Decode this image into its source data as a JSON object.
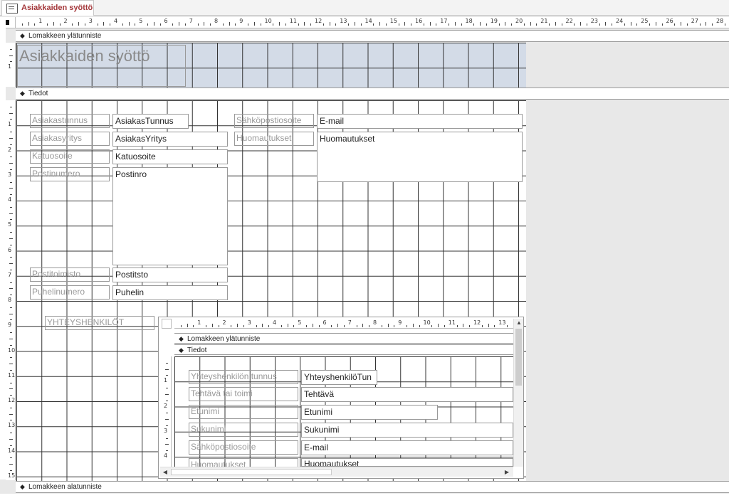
{
  "tab": {
    "title": "Asiakkaiden syöttö"
  },
  "sections": {
    "header": "Lomakkeen ylätunniste",
    "detail": "Tiedot",
    "footer": "Lomakkeen alatunniste"
  },
  "form": {
    "title": "Asiakkaiden syöttö",
    "fields": [
      {
        "label": "Asiakastunnus",
        "control": "AsiakasTunnus"
      },
      {
        "label": "Asiakasyritys",
        "control": "AsiakasYritys"
      },
      {
        "label": "Katuosoite",
        "control": "Katuosoite"
      },
      {
        "label": "Postinumero",
        "control": "Postinro"
      },
      {
        "label": "Postitoimisto",
        "control": "Postitsto"
      },
      {
        "label": "Puhelinumero",
        "control": "Puhelin"
      },
      {
        "label": "Sähköpostiosoite",
        "control": "E-mail"
      },
      {
        "label": "Huomautukset",
        "control": "Huomautukset"
      }
    ],
    "subform_label": "YHTEYSHENKILÖT"
  },
  "subform": {
    "sections": {
      "header": "Lomakkeen ylätunniste",
      "detail": "Tiedot"
    },
    "fields": [
      {
        "label": "Yhteyshenkilön tunnus",
        "control": "YhteyshenkilöTun"
      },
      {
        "label": "Tehtävä tai toimi",
        "control": "Tehtävä"
      },
      {
        "label": "Etunimi",
        "control": "Etunimi"
      },
      {
        "label": "Sukunimi",
        "control": "Sukunimi"
      },
      {
        "label": "Sähköpostiosoite",
        "control": "E-mail"
      },
      {
        "label": "Huomautukset",
        "control": "Huomautukset"
      }
    ]
  },
  "ruler": {
    "main": [
      "1",
      "2",
      "3",
      "4",
      "5",
      "6",
      "7",
      "8",
      "9",
      "10",
      "11",
      "12",
      "13",
      "14",
      "15",
      "16",
      "17",
      "18",
      "19",
      "20",
      "21",
      "22",
      "23",
      "24",
      "25",
      "26",
      "27",
      "28"
    ],
    "sub": [
      "1",
      "2",
      "3",
      "4",
      "5",
      "6",
      "7",
      "8",
      "9",
      "10",
      "11",
      "12",
      "13"
    ],
    "vmain": [
      "1",
      "2",
      "3",
      "4",
      "5",
      "6",
      "7",
      "8",
      "9",
      "10",
      "11",
      "12",
      "13",
      "14",
      "15"
    ],
    "vheader": [
      "1"
    ],
    "vsub": [
      "1",
      "2",
      "3",
      "4"
    ]
  },
  "icons": {
    "tab": "form-icon",
    "section": "section-arrow-icon",
    "scroll_left": "scroll-left-icon",
    "scroll_right": "scroll-right-icon",
    "scroll_up": "scroll-up-icon"
  }
}
